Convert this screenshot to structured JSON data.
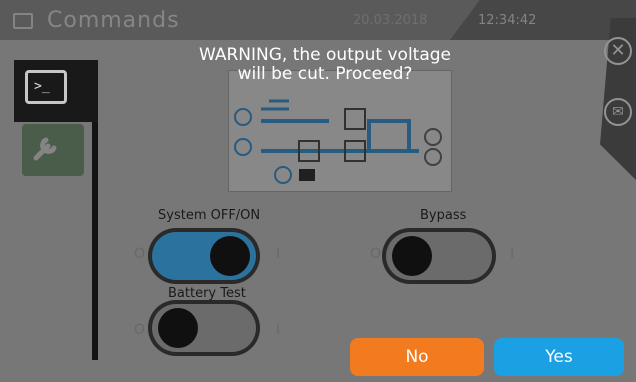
{
  "header": {
    "title": "Commands",
    "date": "20.03.2018",
    "time": "12:34:42"
  },
  "sidebar": {
    "items": [
      {
        "name": "commands",
        "icon": "terminal-icon",
        "glyph": ">_",
        "active": true
      },
      {
        "name": "settings",
        "icon": "wrench-icon",
        "glyph": "🔧",
        "active": false
      }
    ]
  },
  "right_panel": {
    "close_icon": "close-icon",
    "close_glyph": "✕",
    "message_icon": "envelope-icon",
    "message_glyph": "✉"
  },
  "controls": {
    "system": {
      "label": "System OFF/ON",
      "off": "O",
      "on": "I",
      "state": true
    },
    "bypass": {
      "label": "Bypass",
      "off": "O",
      "on": "I",
      "state": false
    },
    "battery_test": {
      "label": "Battery Test",
      "off": "O",
      "on": "I",
      "state": false
    }
  },
  "dialog": {
    "message_line1": "WARNING, the output voltage",
    "message_line2": "will be cut. Proceed?",
    "no_label": "No",
    "yes_label": "Yes"
  },
  "colors": {
    "accent_blue": "#1ca0e4",
    "accent_orange": "#f27a1f",
    "toggle_on": "#2e77a6"
  }
}
